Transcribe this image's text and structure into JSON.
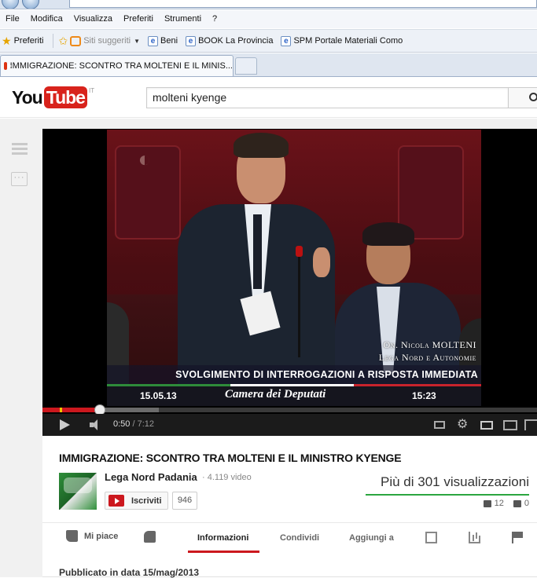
{
  "menubar": [
    "File",
    "Modifica",
    "Visualizza",
    "Preferiti",
    "Strumenti",
    "?"
  ],
  "favorites": {
    "preferiti_label": "Preferiti",
    "items": [
      "Siti suggeriti",
      "Beni",
      "BOOK La Provincia",
      "SPM Portale Materiali Como"
    ]
  },
  "browser_tab": {
    "title": "IMMIGRAZIONE: SCONTRO TRA MOLTENI E IL MINIS..."
  },
  "youtube": {
    "logo_you": "You",
    "logo_tube": "Tube",
    "logo_region": "IT",
    "search_value": "molteni kyenge"
  },
  "player": {
    "caption_name": "On. Nicola MOLTENI",
    "caption_party": "Lega Nord e Autonomie",
    "caption_band": "SVOLGIMENTO DI INTERROGAZIONI A RISPOSTA IMMEDIATA",
    "caption_date": "15.05.13",
    "caption_chamber": "Camera dei Deputati",
    "caption_time": "15:23",
    "current_time": "0:50",
    "duration": "7:12",
    "progress_fraction": 0.116,
    "buffered_fraction": 0.235
  },
  "video": {
    "title": "IMMIGRAZIONE: SCONTRO TRA MOLTENI E IL MINISTRO KYENGE",
    "channel_name": "Lega Nord Padania",
    "video_count": "· 4.119 video",
    "subscribe_label": "Iscriviti",
    "subscriber_count": "946",
    "views": "Più di 301 visualizzazioni",
    "likes": "12",
    "dislikes": "0",
    "published": "Pubblicato in data 15/mag/2013"
  },
  "actions": {
    "like_label": "Mi piace",
    "tabs": [
      "Informazioni",
      "Condividi",
      "Aggiungi a"
    ]
  }
}
